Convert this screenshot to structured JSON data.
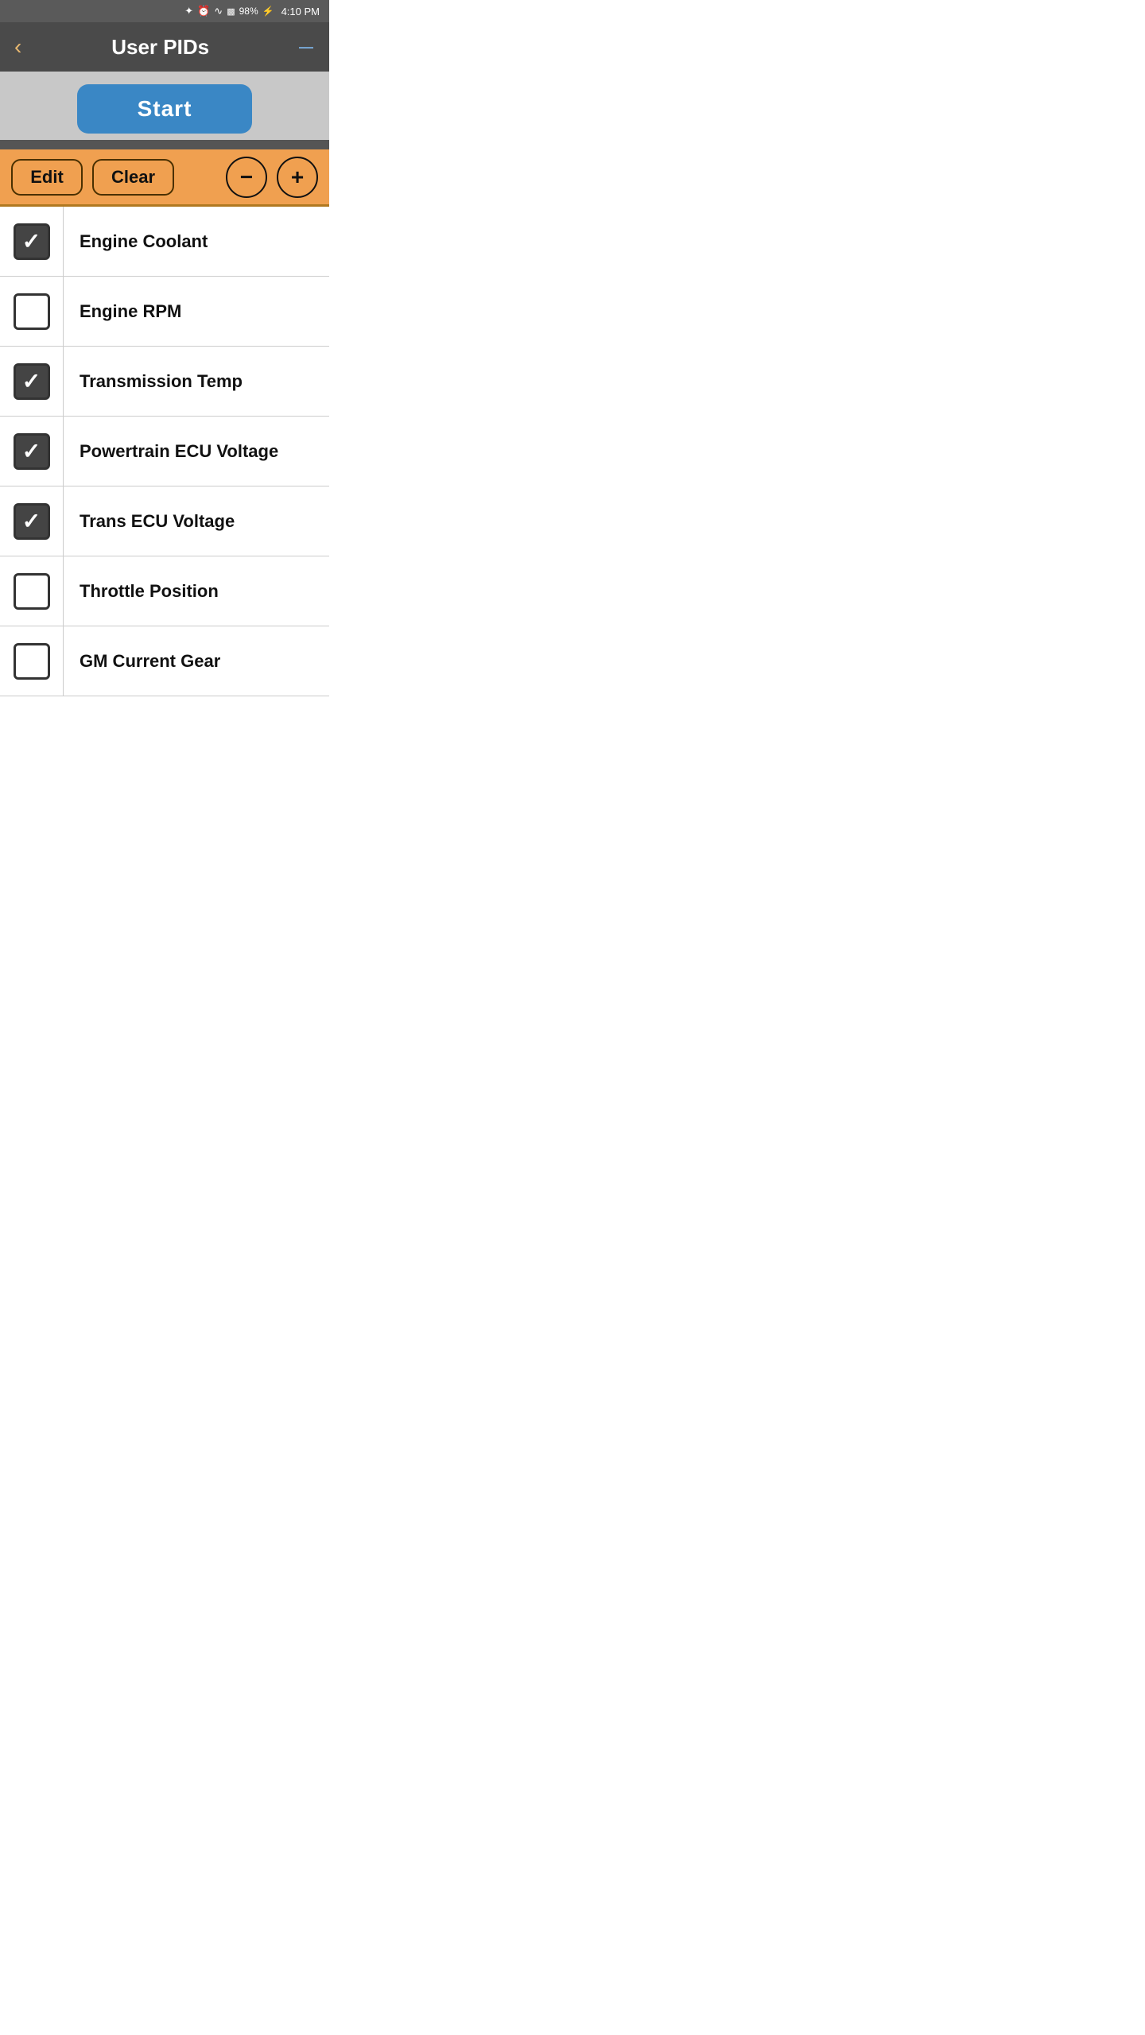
{
  "statusBar": {
    "battery": "98%",
    "time": "4:10 PM"
  },
  "navBar": {
    "backLabel": "‹",
    "title": "User PIDs",
    "menuLabel": "—"
  },
  "startButton": {
    "label": "Start"
  },
  "toolbar": {
    "editLabel": "Edit",
    "clearLabel": "Clear",
    "minusLabel": "−",
    "plusLabel": "+"
  },
  "pidItems": [
    {
      "id": "engine-coolant",
      "label": "Engine Coolant",
      "checked": true
    },
    {
      "id": "engine-rpm",
      "label": "Engine RPM",
      "checked": false
    },
    {
      "id": "transmission-temp",
      "label": "Transmission Temp",
      "checked": true
    },
    {
      "id": "powertrain-ecu-voltage",
      "label": "Powertrain ECU Voltage",
      "checked": true
    },
    {
      "id": "trans-ecu-voltage",
      "label": "Trans ECU Voltage",
      "checked": true
    },
    {
      "id": "throttle-position",
      "label": "Throttle Position",
      "checked": false
    },
    {
      "id": "gm-current-gear",
      "label": "GM Current Gear",
      "checked": false
    }
  ],
  "colors": {
    "accent": "#f0a050",
    "startBlue": "#3a87c5",
    "navDark": "#4a4a4a",
    "statusGray": "#5a5a5a"
  }
}
